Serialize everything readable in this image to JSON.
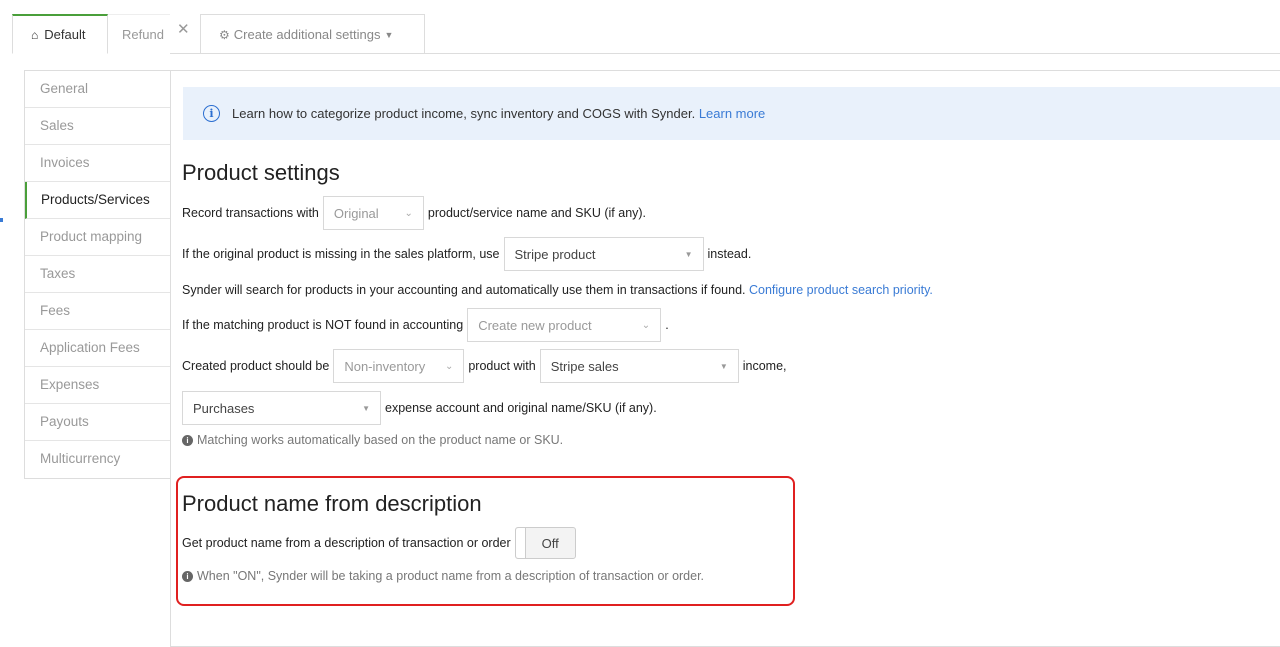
{
  "tabs": {
    "default": "Default",
    "refund": "Refund",
    "close": "✕",
    "create": "Create additional settings"
  },
  "sidebar": {
    "items": [
      {
        "label": "General"
      },
      {
        "label": "Sales"
      },
      {
        "label": "Invoices"
      },
      {
        "label": "Products/Services"
      },
      {
        "label": "Product mapping"
      },
      {
        "label": "Taxes"
      },
      {
        "label": "Fees"
      },
      {
        "label": "Application Fees"
      },
      {
        "label": "Expenses"
      },
      {
        "label": "Payouts"
      },
      {
        "label": "Multicurrency"
      }
    ],
    "active": "Products/Services"
  },
  "info": {
    "text": "Learn how to categorize product income, sync inventory and COGS with Synder.",
    "link": "Learn more"
  },
  "product_settings": {
    "title": "Product settings",
    "row1": {
      "before": "Record transactions with",
      "select": "Original",
      "after": "product/service name and SKU (if any)."
    },
    "row2": {
      "before": "If the original product is missing in the sales platform, use",
      "select": "Stripe product",
      "after": "instead."
    },
    "row3": {
      "text": "Synder will search for products in your accounting and automatically use them in transactions if found.",
      "link": "Configure product search priority."
    },
    "row4": {
      "before": "If the matching product is NOT found in accounting",
      "select": "Create new product",
      "after": "."
    },
    "row5": {
      "before": "Created product should be",
      "select1": "Non-inventory",
      "middle": "product with",
      "select2": "Stripe sales",
      "after": "income,"
    },
    "row6": {
      "select": "Purchases",
      "after": "expense account and original name/SKU (if any)."
    },
    "hint": "Matching works automatically based on the product name or SKU."
  },
  "description_section": {
    "title": "Product name from description",
    "label": "Get product name from a description of transaction or order",
    "toggle": "Off",
    "hint": "When \"ON\", Synder will be taking a product name from a description of transaction or order."
  },
  "colors": {
    "accent": "#4a9f3a",
    "link": "#3a7bd5",
    "highlight": "#e02020",
    "info_bg": "#e9f1fb"
  }
}
